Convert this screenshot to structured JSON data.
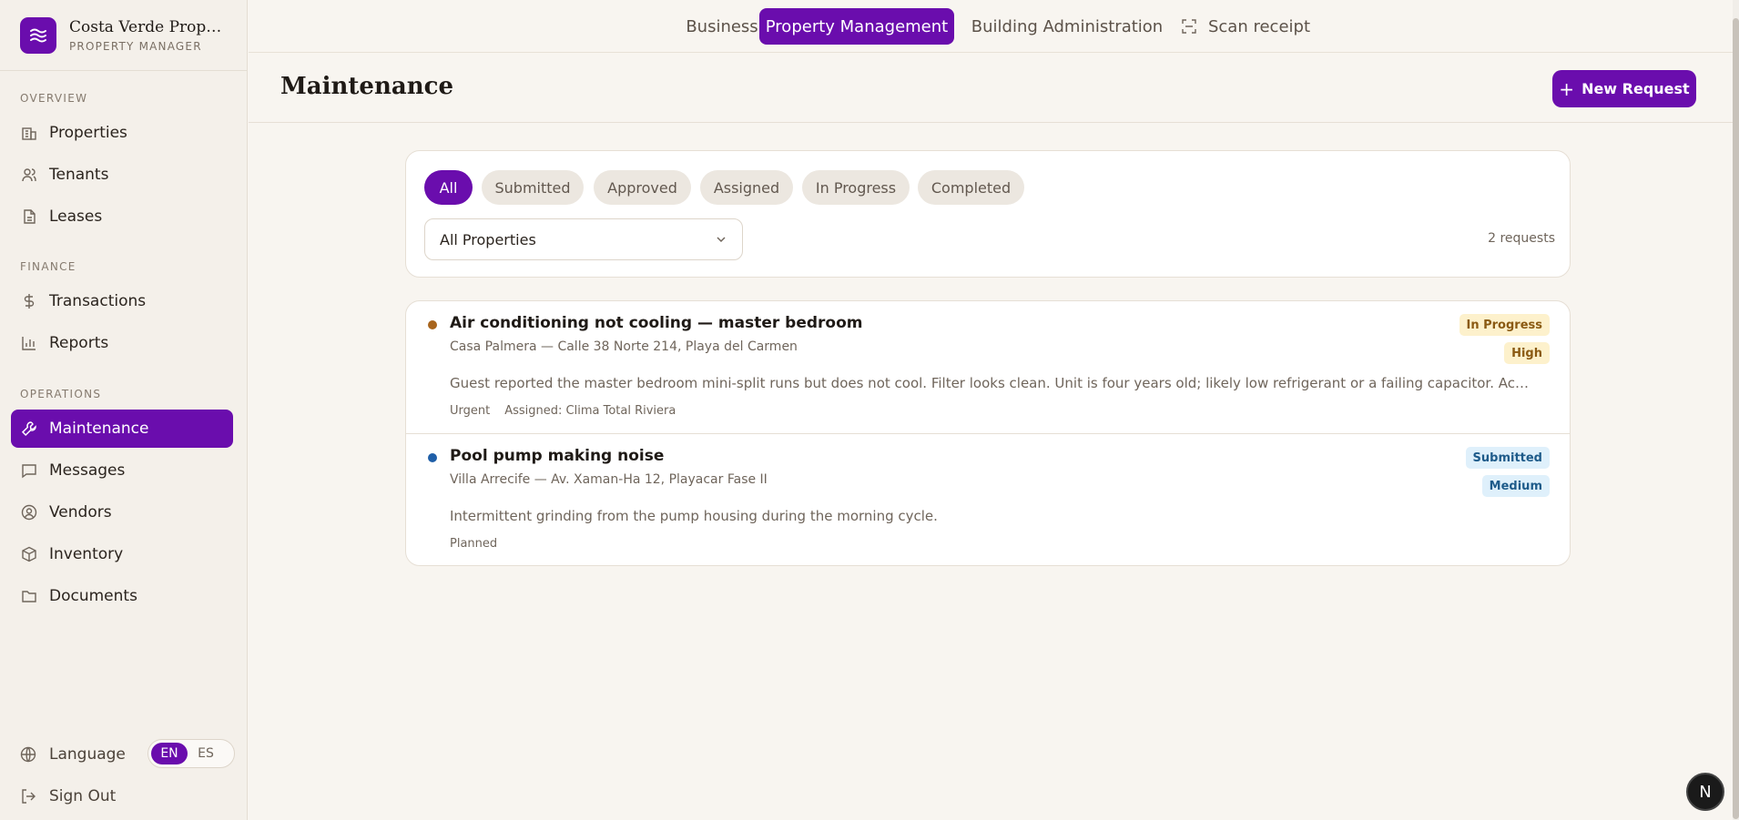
{
  "brand": {
    "name": "Costa Verde Proper...",
    "subtitle": "PROPERTY MANAGER"
  },
  "sidebar": {
    "sections": [
      {
        "label": "OVERVIEW",
        "items": [
          "Properties",
          "Tenants",
          "Leases"
        ]
      },
      {
        "label": "FINANCE",
        "items": [
          "Transactions",
          "Reports"
        ]
      },
      {
        "label": "OPERATIONS",
        "items": [
          "Maintenance",
          "Messages",
          "Vendors",
          "Inventory",
          "Documents"
        ]
      }
    ],
    "active_item": "Maintenance",
    "language_label": "Language",
    "lang_en": "EN",
    "lang_es": "ES",
    "signout_label": "Sign Out"
  },
  "topnav": {
    "tabs": [
      "Business",
      "Property Management",
      "Building Administration",
      "Scan receipt"
    ],
    "active": "Property Management"
  },
  "header": {
    "title": "Maintenance",
    "new_button": "New Request"
  },
  "filters": {
    "chips": [
      "All",
      "Submitted",
      "Approved",
      "Assigned",
      "In Progress",
      "Completed"
    ],
    "active": "All",
    "property_select": "All Properties",
    "count_text": "2 requests"
  },
  "requests": [
    {
      "title": "Air conditioning not cooling — master bedroom",
      "address": "Casa Palmera — Calle 38 Norte 214, Playa del Carmen",
      "description": "Guest reported the master bedroom mini-split runs but does not cool. Filter looks clean. Unit is four years old; likely low refrigerant or a failing capacitor. Access via the front…",
      "meta": [
        "Urgent",
        "Assigned: Clima Total Riviera"
      ],
      "status": "In Progress",
      "priority": "High",
      "dot_color": "#a8651d"
    },
    {
      "title": "Pool pump making noise",
      "address": "Villa Arrecife — Av. Xaman-Ha 12, Playacar Fase II",
      "description": "Intermittent grinding from the pump housing during the morning cycle.",
      "meta": [
        "Planned"
      ],
      "status": "Submitted",
      "priority": "Medium",
      "dot_color": "#1f5fa8"
    }
  ],
  "colors": {
    "accent": "#6a0dad",
    "background": "#f8f5f0"
  },
  "floating_button": "N"
}
